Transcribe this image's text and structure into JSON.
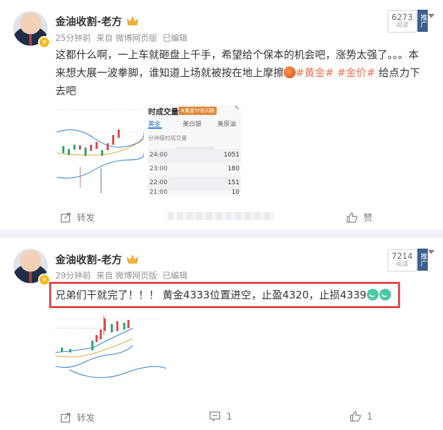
{
  "posts": [
    {
      "author": "金油收割-老方",
      "time": "25分钟前",
      "source": "来自 微博网页版",
      "edited": "已编辑",
      "reads": "6273",
      "reads_label": "阅读",
      "promo_label": "推广",
      "text_main": "这都什么啊，一上车就砸盘上千手，希望给个保本的机会吧，涨势太强了。。。本来想大展一波拳脚，谁知道上场就被按在地上摩擦",
      "tag1": "#黄金#",
      "tag2": "#金价#",
      "text_tail": "给点力下去吧",
      "panel": {
        "title": "时成交量",
        "badge": "#黄金YF价闪跌",
        "tab_active": "黄金",
        "tab2": "美白银",
        "tab3": "美原油",
        "subtitle": "分钟级时成交量",
        "rows": [
          {
            "time": "24:00",
            "value": "1051"
          },
          {
            "time": "23:00",
            "value": "180"
          },
          {
            "time": "22:00",
            "value": "151"
          },
          {
            "time": "21:00",
            "value": "10"
          }
        ]
      },
      "actions": {
        "forward": "转发",
        "like": "赞"
      }
    },
    {
      "author": "金油收割-老方",
      "time": "29分钟前",
      "source": "来自 微博网页版",
      "edited": "已编辑",
      "reads": "7214",
      "reads_label": "阅读",
      "promo_label": "推广",
      "text": "兄弟们干就完了！！！ 黄金4333位置进空，止盈4320，止损4339",
      "actions": {
        "forward": "转发",
        "comment_count": "1",
        "like_count": "1"
      }
    }
  ],
  "colors": {
    "tag": "#eb7350",
    "highlight_border": "#e04a4a",
    "promo_bg": "#3b5f8f",
    "meta_text": "#939393"
  }
}
